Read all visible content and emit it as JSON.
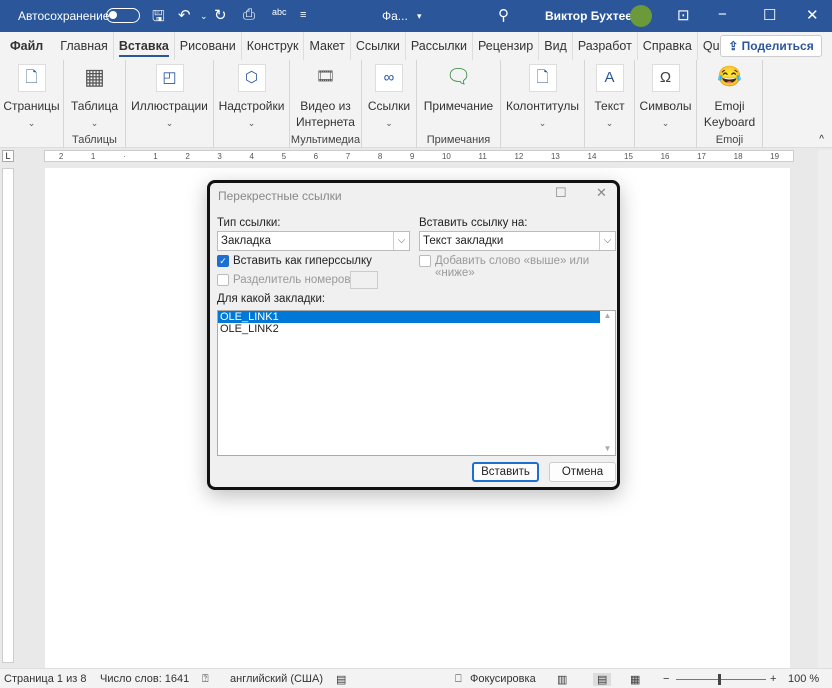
{
  "titlebar": {
    "autosave": "Автосохранение",
    "doc_title": "Фа...",
    "user": "Виктор Бухтеев"
  },
  "tabs": [
    "Файл",
    "Главная",
    "Вставка",
    "Рисовани",
    "Конструк",
    "Макет",
    "Ссылки",
    "Рассылки",
    "Рецензир",
    "Вид",
    "Разработ",
    "Справка",
    "QuillBot"
  ],
  "active_tab": "Вставка",
  "share": "Поделиться",
  "ribbon": {
    "pages": "Страницы",
    "table": "Таблица",
    "tables_group": "Таблицы",
    "illustrations": "Иллюстрации",
    "addins": "Надстройки",
    "video1": "Видео из",
    "video2": "Интернета",
    "media_group": "Мультимедиа",
    "links": "Ссылки",
    "comment": "Примечание",
    "comments_group": "Примечания",
    "headers": "Колонтитулы",
    "text": "Текст",
    "symbols": "Символы",
    "emoji1": "Emoji",
    "emoji2": "Keyboard",
    "emoji_group": "Emoji"
  },
  "ruler": [
    "2",
    "1",
    "·",
    "1",
    "2",
    "3",
    "4",
    "5",
    "6",
    "7",
    "8",
    "9",
    "10",
    "11",
    "12",
    "13",
    "14",
    "15",
    "16",
    "17",
    "18",
    "19"
  ],
  "dialog": {
    "title": "Перекрестные ссылки",
    "ref_type_label": "Тип ссылки:",
    "ref_type_value": "Закладка",
    "insert_ref_label": "Вставить ссылку на:",
    "insert_ref_value": "Текст закладки",
    "hyperlink_label": "Вставить как гиперссылку",
    "hyperlink_checked": true,
    "above_below_label": "Добавить слово «выше» или «ниже»",
    "above_below_checked": false,
    "separator_label": "Разделитель номеров",
    "separator_checked": false,
    "which_label": "Для какой закладки:",
    "items": [
      "OLE_LINK1",
      "OLE_LINK2"
    ],
    "selected_item": "OLE_LINK1",
    "insert_btn": "Вставить",
    "cancel_btn": "Отмена"
  },
  "status": {
    "page": "Страница 1 из 8",
    "words": "Число слов: 1641",
    "language": "английский (США)",
    "focus": "Фокусировка",
    "zoom": "100 %"
  },
  "colors": {
    "titlebar": "#2b579a",
    "accent": "#0078d7"
  }
}
